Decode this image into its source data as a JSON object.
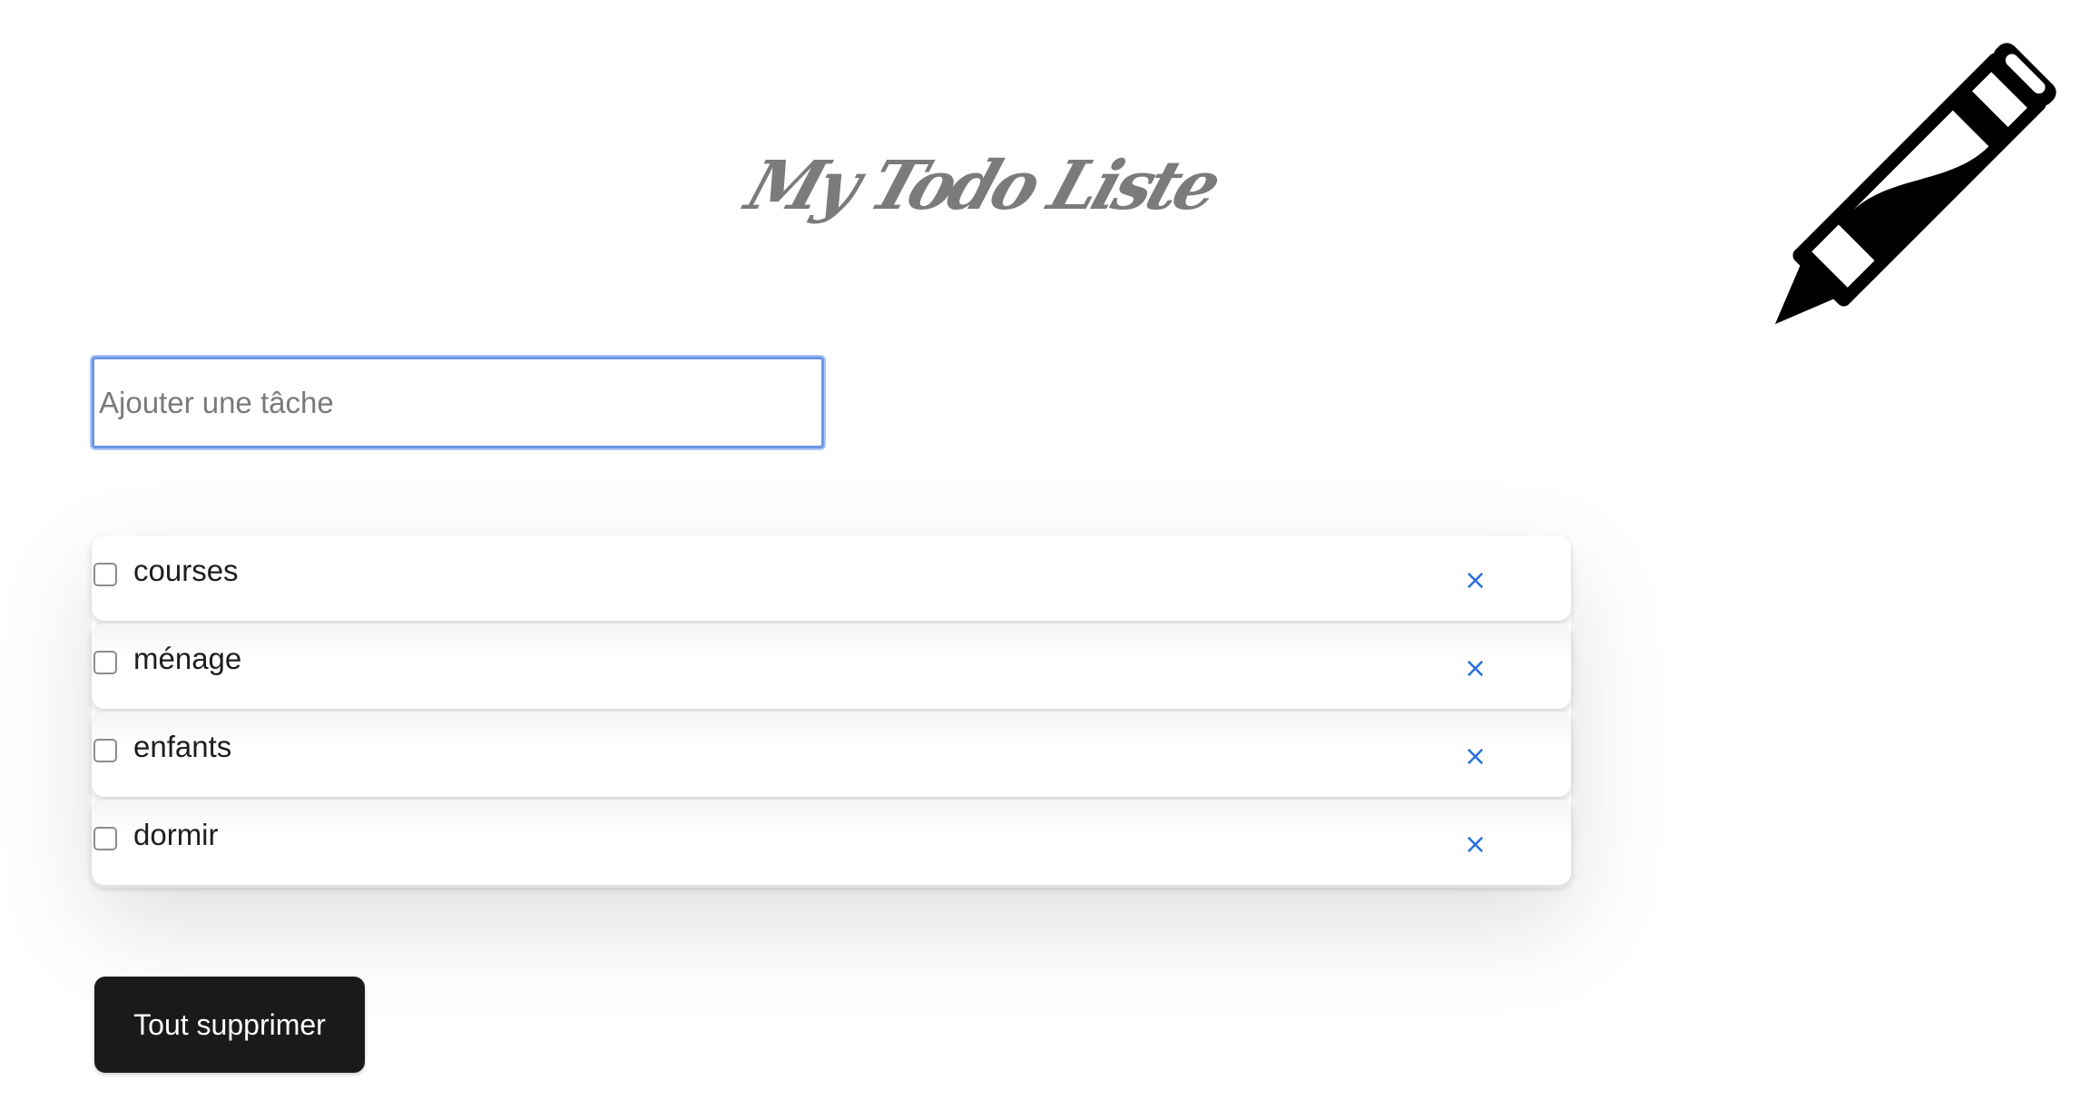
{
  "header": {
    "title": "My Todo Liste"
  },
  "input": {
    "placeholder": "Ajouter une tâche",
    "value": ""
  },
  "tasks": [
    {
      "label": "courses",
      "checked": false,
      "delete_glyph": "×"
    },
    {
      "label": "ménage",
      "checked": false,
      "delete_glyph": "×"
    },
    {
      "label": "enfants",
      "checked": false,
      "delete_glyph": "×"
    },
    {
      "label": "dormir",
      "checked": false,
      "delete_glyph": "×"
    }
  ],
  "actions": {
    "clear_all_label": "Tout supprimer"
  },
  "icons": {
    "decoration": "pencil-icon",
    "delete": "close-icon"
  },
  "colors": {
    "title": "#7b7b7b",
    "input_focus": "#6c96e6",
    "delete_accent": "#2a6fe0",
    "button_bg": "#1a1a1a",
    "button_text": "#ffffff"
  }
}
